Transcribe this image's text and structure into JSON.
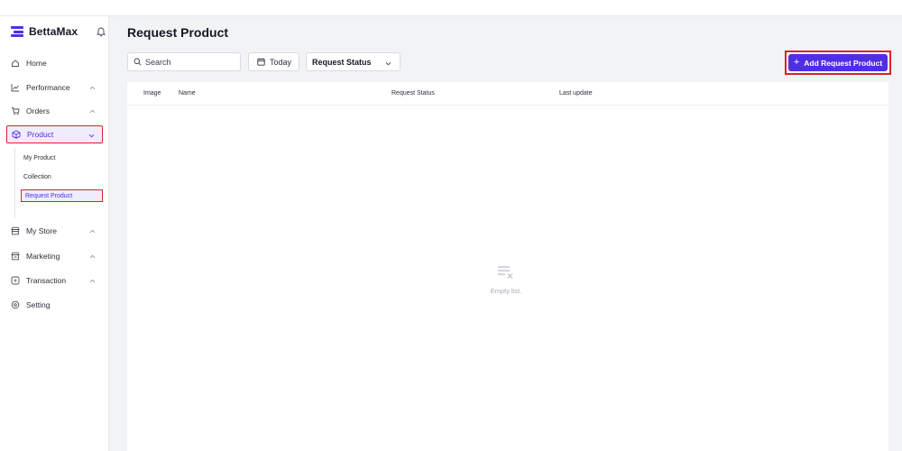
{
  "brand": {
    "name": "BettaMax",
    "color": "#4f2ee6"
  },
  "sidebar": {
    "items": [
      {
        "label": "Home",
        "icon": "home-icon"
      },
      {
        "label": "Performance",
        "icon": "chart-icon"
      },
      {
        "label": "Orders",
        "icon": "cart-icon"
      },
      {
        "label": "Product",
        "icon": "box-icon"
      },
      {
        "label": "My Store",
        "icon": "store-icon"
      },
      {
        "label": "Marketing",
        "icon": "megaphone-icon"
      },
      {
        "label": "Transaction",
        "icon": "wallet-icon"
      },
      {
        "label": "Setting",
        "icon": "gear-icon"
      }
    ],
    "product_sub": [
      {
        "label": "My Product"
      },
      {
        "label": "Collection"
      },
      {
        "label": "Request Product"
      }
    ]
  },
  "main": {
    "title": "Request Product",
    "search": {
      "placeholder": "Search"
    },
    "date_filter": {
      "label": "Today"
    },
    "status_filter": {
      "label": "Request Status"
    },
    "add_button": {
      "label": "Add Request Product"
    },
    "table": {
      "columns": [
        "Image",
        "Name",
        "Request Status",
        "Last update"
      ],
      "rows": [],
      "empty_text": "Empty list."
    }
  },
  "colors": {
    "accent": "#4f2ee6",
    "highlight_border": "#e0202a",
    "background": "#f2f3f5"
  }
}
